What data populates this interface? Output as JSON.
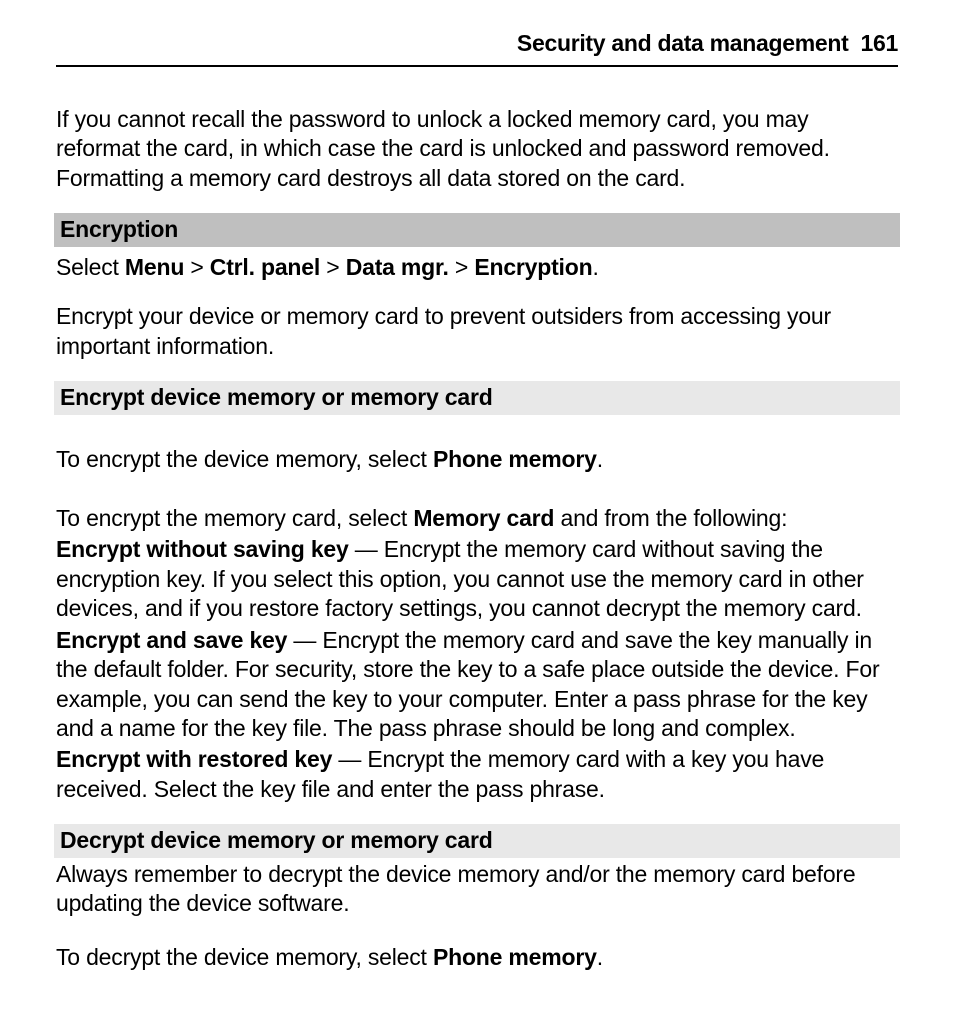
{
  "header": {
    "title": "Security and data management",
    "page_number": "161"
  },
  "intro_para": "If you cannot recall the password to unlock a locked memory card, you may reformat the card, in which case the card is unlocked and password removed. Formatting a memory card destroys all data stored on the card.",
  "section_encryption": {
    "heading": "Encryption",
    "nav": {
      "prefix": "Select ",
      "item1": "Menu",
      "sep": " > ",
      "item2": "Ctrl. panel",
      "item3": "Data mgr.",
      "item4": "Encryption",
      "suffix": "."
    },
    "desc": "Encrypt your device or memory card to prevent outsiders from accessing your important information."
  },
  "encrypt_section": {
    "heading": "Encrypt device memory or memory card",
    "p1_a": "To encrypt the device memory, select ",
    "p1_b": "Phone memory",
    "p1_c": ".",
    "p2_a": "To encrypt the memory card, select ",
    "p2_b": "Memory card",
    "p2_c": " and from the following:",
    "opts": [
      {
        "label": "Encrypt without saving key",
        "text": "  — Encrypt the memory card without saving the encryption key. If you select this option, you cannot use the memory card in other devices, and if you restore factory settings, you cannot decrypt the memory card."
      },
      {
        "label": "Encrypt and save key",
        "text": "  — Encrypt the memory card and save the key manually in the default folder. For security, store the key to a safe place outside the device. For example, you can send the key to your computer. Enter a pass phrase for the key and a name for the key file. The pass phrase should be long and complex."
      },
      {
        "label": "Encrypt with restored key",
        "text": "  — Encrypt the memory card with a key you have received. Select the key file and enter the pass phrase."
      }
    ]
  },
  "decrypt_section": {
    "heading": "Decrypt device memory or memory card",
    "p1": "Always remember to decrypt the device memory and/or the memory card before updating the device software.",
    "p2_a": "To decrypt the device memory, select ",
    "p2_b": "Phone memory",
    "p2_c": "."
  }
}
